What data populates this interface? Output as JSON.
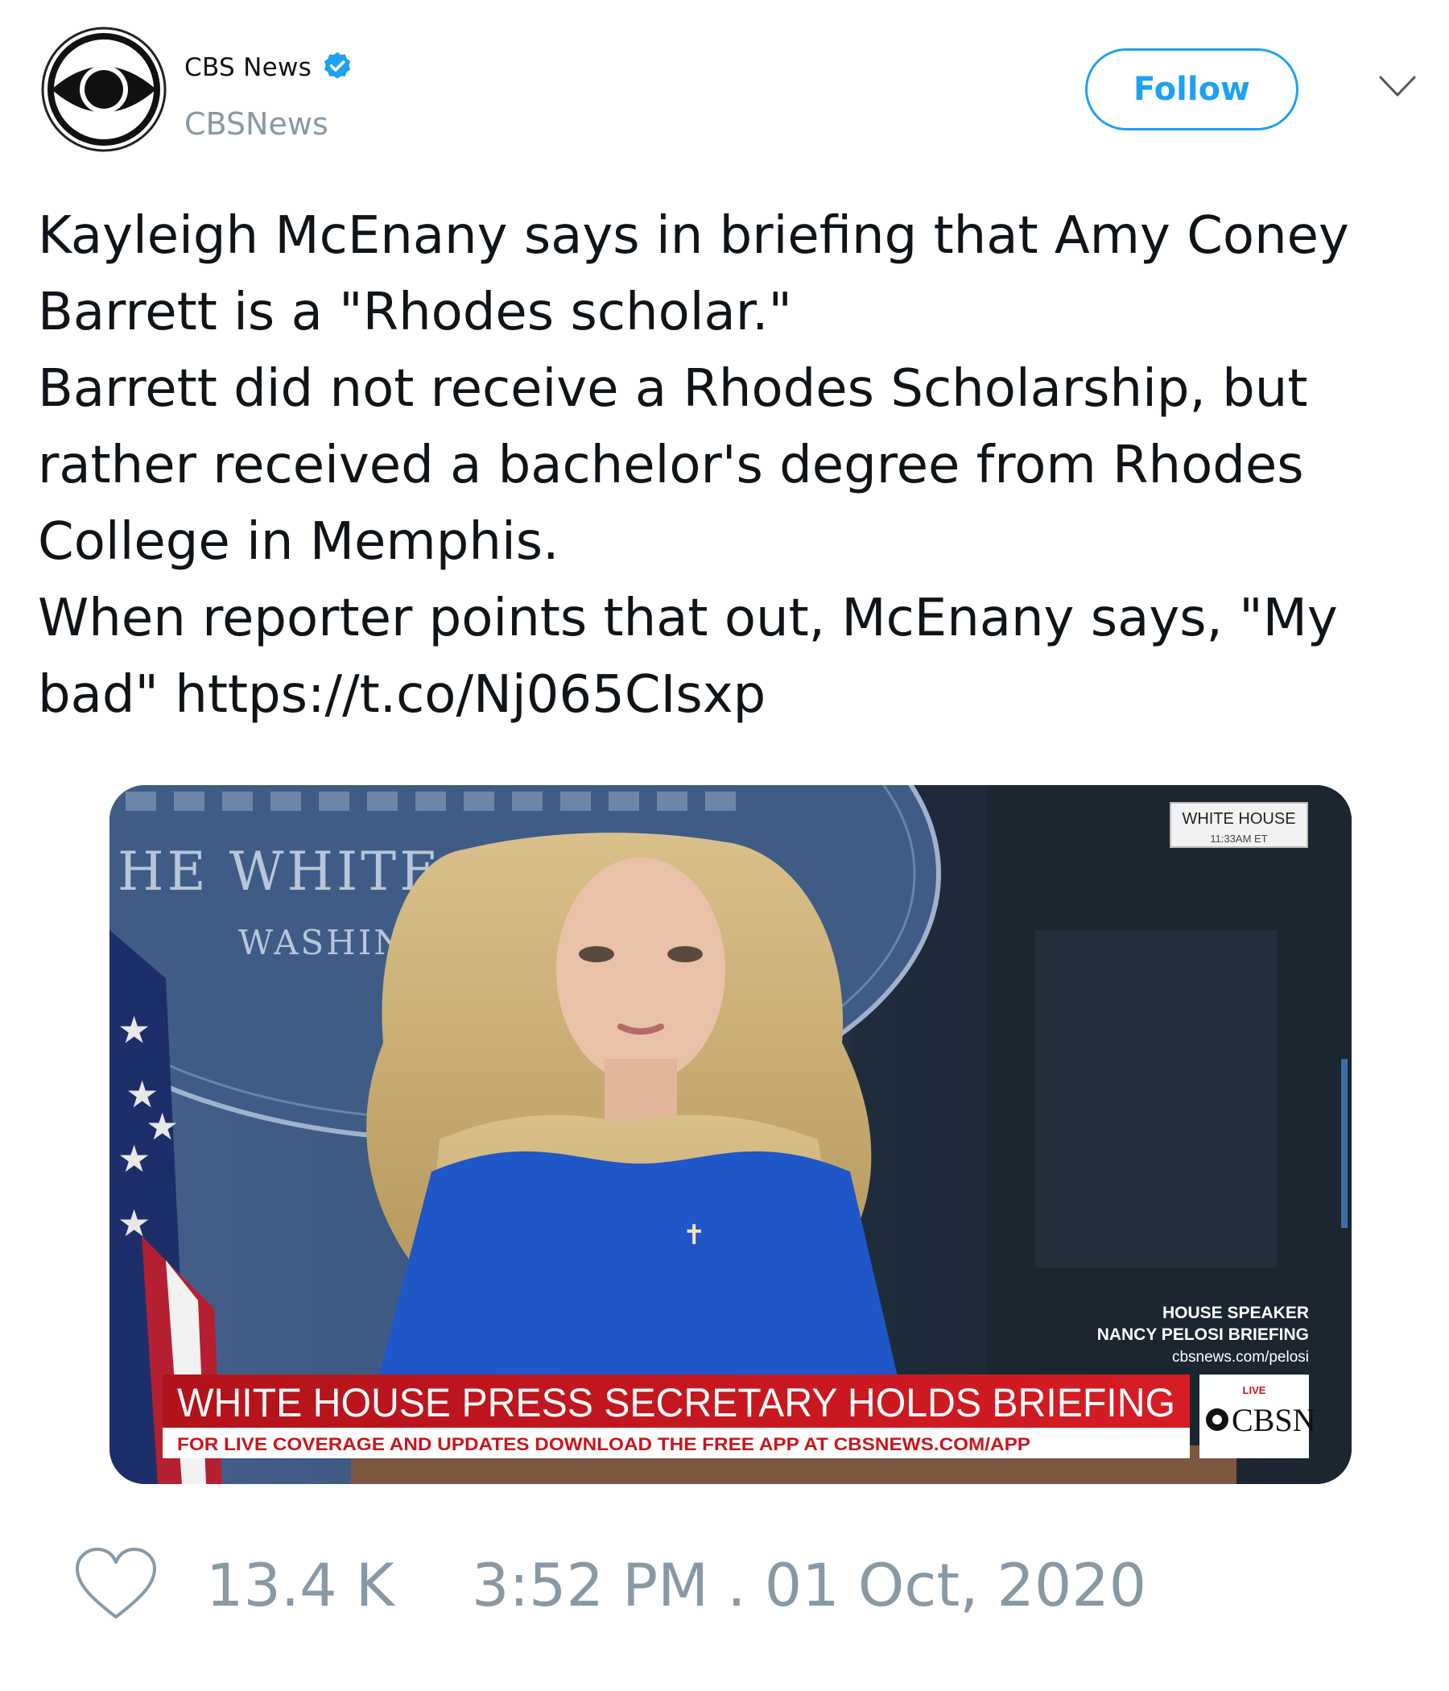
{
  "account": {
    "display_name": "CBS News",
    "handle": "CBSNews",
    "verified": true,
    "avatar_icon": "cbs-eye-logo"
  },
  "actions": {
    "follow_label": "Follow",
    "menu_icon": "chevron-down-icon"
  },
  "tweet": {
    "paragraphs": [
      "Kayleigh McEnany says in briefing that Amy Coney Barrett is a \"Rhodes scholar.\"",
      "Barrett did not receive a Rhodes Scholarship, but rather received a bachelor's degree from Rhodes College in Memphis.",
      "When reporter points that out, McEnany says, \"My bad\" https://t.co/Nj065CIsxp"
    ]
  },
  "media": {
    "seal_line1": "HE WHITE HOU",
    "seal_line2": "WASHINGTON",
    "location_box": {
      "title": "WHITE HOUSE",
      "time": "11:33AM ET"
    },
    "side_note": [
      "HOUSE SPEAKER",
      "NANCY PELOSI BRIEFING",
      "cbsnews.com/pelosi"
    ],
    "lower_third": {
      "headline": "WHITE HOUSE PRESS SECRETARY HOLDS BRIEFING",
      "subline": "FOR LIVE COVERAGE AND UPDATES DOWNLOAD THE FREE APP AT CBSNEWS.COM/APP"
    },
    "network_badge": {
      "live": "LIVE",
      "name": "CBSN"
    },
    "colors": {
      "lower_third_red": "#c8161d",
      "podium_blue": "#2d4a72",
      "dress_blue": "#1f56c8"
    }
  },
  "footer": {
    "like_icon": "heart-icon",
    "like_count": "13.4 K",
    "timestamp": "3:52 PM . 01 Oct, 2020"
  }
}
